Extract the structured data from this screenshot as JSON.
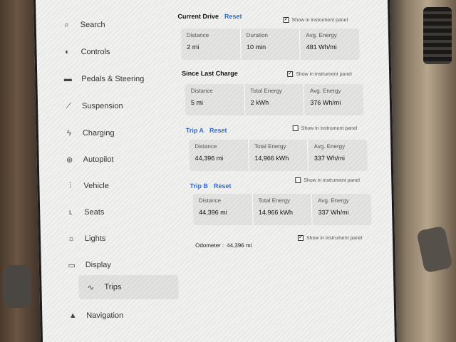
{
  "nav": {
    "items": [
      {
        "label": "Search",
        "icon": "search-icon"
      },
      {
        "label": "Controls",
        "icon": "controls-icon"
      },
      {
        "label": "Pedals & Steering",
        "icon": "car-icon"
      },
      {
        "label": "Suspension",
        "icon": "suspension-icon"
      },
      {
        "label": "Charging",
        "icon": "lightning-icon"
      },
      {
        "label": "Autopilot",
        "icon": "steering-wheel-icon"
      },
      {
        "label": "Vehicle",
        "icon": "sliders-icon"
      },
      {
        "label": "Seats",
        "icon": "seat-icon"
      },
      {
        "label": "Lights",
        "icon": "sun-icon"
      },
      {
        "label": "Display",
        "icon": "display-icon"
      },
      {
        "label": "Trips",
        "icon": "trips-icon"
      },
      {
        "label": "Navigation",
        "icon": "navigation-icon"
      }
    ],
    "active": "Trips"
  },
  "current_drive": {
    "title": "Current Drive",
    "reset_label": "Reset",
    "show_label": "Show in instrument panel",
    "stats": [
      {
        "label": "Distance",
        "value": "2 mi"
      },
      {
        "label": "Duration",
        "value": "10 min"
      },
      {
        "label": "Avg. Energy",
        "value": "481 Wh/mi"
      }
    ]
  },
  "since_last_charge": {
    "title": "Since Last Charge",
    "show_label": "Show in instrument panel",
    "stats": [
      {
        "label": "Distance",
        "value": "5 mi"
      },
      {
        "label": "Total Energy",
        "value": "2 kWh"
      },
      {
        "label": "Avg. Energy",
        "value": "376 Wh/mi"
      }
    ]
  },
  "trip_a": {
    "title": "Trip A",
    "reset_label": "Reset",
    "show_label": "Show in instrument panel",
    "stats": [
      {
        "label": "Distance",
        "value": "44,396 mi"
      },
      {
        "label": "Total Energy",
        "value": "14,966 kWh"
      },
      {
        "label": "Avg. Energy",
        "value": "337 Wh/mi"
      }
    ]
  },
  "trip_b": {
    "title": "Trip B",
    "reset_label": "Reset",
    "show_label": "Show in instrument panel",
    "stats": [
      {
        "label": "Distance",
        "value": "44,396 mi"
      },
      {
        "label": "Total Energy",
        "value": "14,966 kWh"
      },
      {
        "label": "Avg. Energy",
        "value": "337 Wh/mi"
      }
    ]
  },
  "odometer": {
    "label": "Odometer :",
    "value": "44,396 mi",
    "show_label": "Show in instrument panel"
  },
  "colors": {
    "accent": "#2f6fd6",
    "screen_bg": "#f1f1f0",
    "box_bg": "#e4e4e2"
  }
}
